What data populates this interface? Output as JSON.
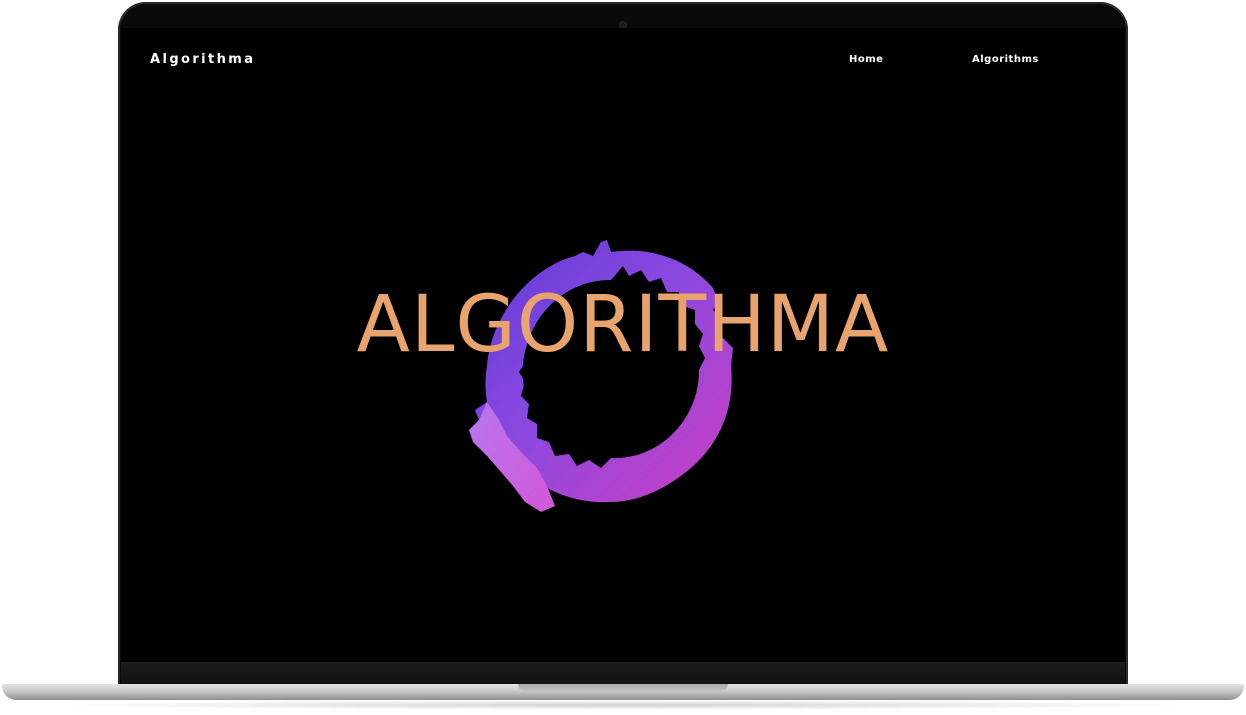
{
  "site": {
    "brand": "Algorithma",
    "nav": [
      {
        "label": "Home"
      },
      {
        "label": "Algorithms"
      }
    ]
  },
  "hero": {
    "title": "ALGORITHMA",
    "graphic_icon": "purple-wave-ring-icon"
  },
  "colors": {
    "background": "#000000",
    "title": "#e9a46e",
    "ring_start": "#6b3fd8",
    "ring_end": "#c23fc9",
    "nav_text": "#ffffff"
  },
  "device": {
    "frame_icon": "laptop-frame-icon"
  }
}
